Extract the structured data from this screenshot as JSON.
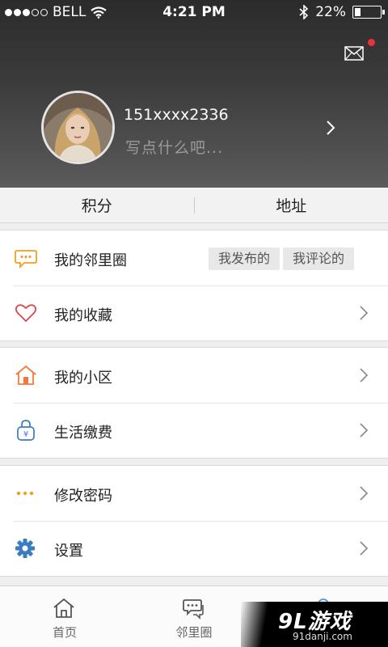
{
  "status_bar": {
    "carrier": "BELL",
    "time": "4:21 PM",
    "battery": "22%",
    "battery_level": 0.22
  },
  "profile": {
    "username": "151xxxx2336",
    "signature": "写点什么吧...",
    "has_unread_messages": true
  },
  "stats": {
    "points_label": "积分",
    "address_label": "地址"
  },
  "menu": {
    "neighborhood_circle": "我的邻里圈",
    "my_posts_chip": "我发布的",
    "my_comments_chip": "我评论的",
    "favorites": "我的收藏",
    "community": "我的小区",
    "bill_payment": "生活缴费",
    "change_password": "修改密码",
    "settings": "设置"
  },
  "tabs": {
    "home": "首页",
    "neighborhood": "邻里圈"
  },
  "watermark": {
    "main": "9L游戏",
    "sub": "91danji.com"
  },
  "colors": {
    "accent_orange": "#f0a020",
    "heart_red": "#e0474c",
    "house_orange": "#f07a3c",
    "gear_blue": "#3a7cc0",
    "badge_red": "#e8323c"
  }
}
